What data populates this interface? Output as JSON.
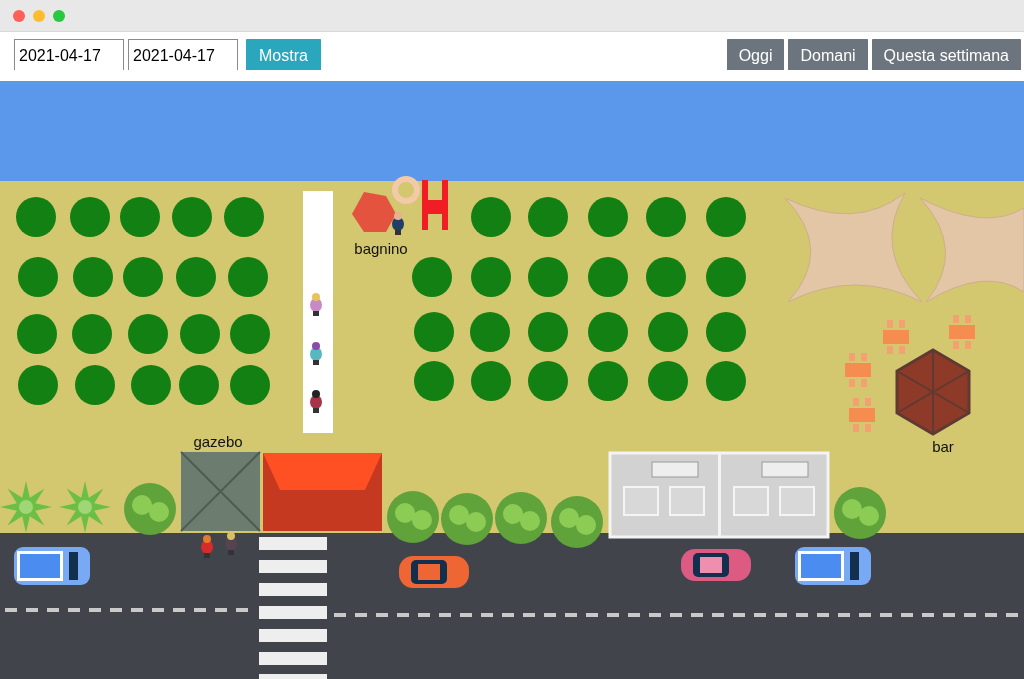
{
  "window": {
    "controls": [
      {
        "color": "#fe5f57"
      },
      {
        "color": "#febc2e"
      },
      {
        "color": "#28c840"
      }
    ]
  },
  "toolbar": {
    "date_from": {
      "value": "2021-04-17"
    },
    "date_to": {
      "value": "2021-04-17"
    },
    "show_button": "Mostra",
    "quick_ranges": [
      "Oggi",
      "Domani",
      "Questa settimana"
    ]
  },
  "map": {
    "labels": [
      {
        "kind": "lifeguard",
        "text": "bagnino"
      },
      {
        "kind": "gazebo",
        "text": "gazebo"
      },
      {
        "kind": "bar",
        "text": "bar"
      }
    ]
  }
}
